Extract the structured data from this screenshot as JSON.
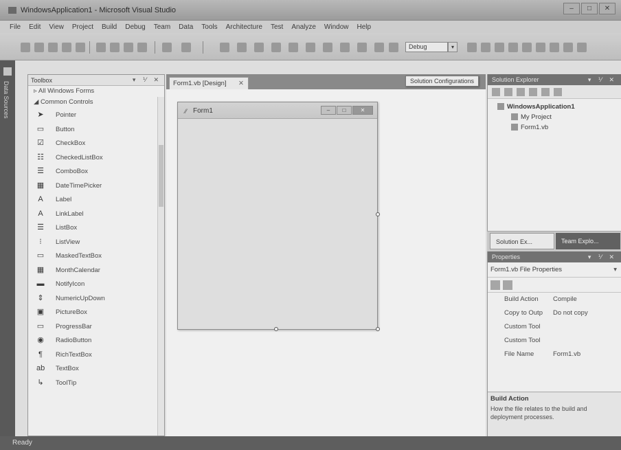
{
  "window": {
    "title": "WindowsApplication1 - Microsoft Visual Studio",
    "min": "–",
    "max": "□",
    "close": "✕"
  },
  "menu": [
    "File",
    "Edit",
    "View",
    "Project",
    "Build",
    "Debug",
    "Team",
    "Data",
    "Tools",
    "Architecture",
    "Test",
    "Analyze",
    "Window",
    "Help"
  ],
  "toolbar": {
    "configuration": "Debug",
    "tooltip": "Solution Configurations"
  },
  "data_sources": {
    "label": "Data Sources"
  },
  "toolbox": {
    "title": "Toolbox",
    "controls": "▾ ⅟ ✕",
    "group_all": "▹ All Windows Forms",
    "group_common": "◢ Common Controls",
    "items": [
      {
        "icon": "➤",
        "label": "Pointer"
      },
      {
        "icon": "▭",
        "label": "Button"
      },
      {
        "icon": "☑",
        "label": "CheckBox"
      },
      {
        "icon": "☷",
        "label": "CheckedListBox"
      },
      {
        "icon": "☰",
        "label": "ComboBox"
      },
      {
        "icon": "▦",
        "label": "DateTimePicker"
      },
      {
        "icon": "A",
        "label": "Label"
      },
      {
        "icon": "A",
        "label": "LinkLabel"
      },
      {
        "icon": "☰",
        "label": "ListBox"
      },
      {
        "icon": "⁝",
        "label": "ListView"
      },
      {
        "icon": "▭",
        "label": "MaskedTextBox"
      },
      {
        "icon": "▦",
        "label": "MonthCalendar"
      },
      {
        "icon": "▬",
        "label": "NotifyIcon"
      },
      {
        "icon": "⇕",
        "label": "NumericUpDown"
      },
      {
        "icon": "▣",
        "label": "PictureBox"
      },
      {
        "icon": "▭",
        "label": "ProgressBar"
      },
      {
        "icon": "◉",
        "label": "RadioButton"
      },
      {
        "icon": "¶",
        "label": "RichTextBox"
      },
      {
        "icon": "ab",
        "label": "TextBox"
      },
      {
        "icon": "↳",
        "label": "ToolTip"
      }
    ]
  },
  "designer": {
    "tab": "Form1.vb [Design]",
    "tab_close": "✕",
    "form": {
      "title": "Form1",
      "icon": "⁄⁄"
    }
  },
  "solution_explorer": {
    "title": "Solution Explorer",
    "controls": "▾ ⅟ ✕",
    "root": "WindowsApplication1",
    "children": [
      "My Project",
      "Form1.vb"
    ],
    "tab1": "Solution Ex...",
    "tab2": "Team Explo..."
  },
  "properties": {
    "title": "Properties",
    "controls": "▾ ⅟ ✕",
    "selected": "Form1.vb File Properties",
    "selected_arrow": "▾",
    "rows": [
      {
        "name": "Build Action",
        "value": "Compile"
      },
      {
        "name": "Copy to Outp",
        "value": "Do not copy"
      },
      {
        "name": "Custom Tool",
        "value": ""
      },
      {
        "name": "Custom Tool",
        "value": ""
      },
      {
        "name": "File Name",
        "value": "Form1.vb"
      }
    ],
    "desc_title": "Build Action",
    "desc_text": "How the file relates to the build and deployment processes."
  },
  "status": {
    "text": "Ready"
  }
}
